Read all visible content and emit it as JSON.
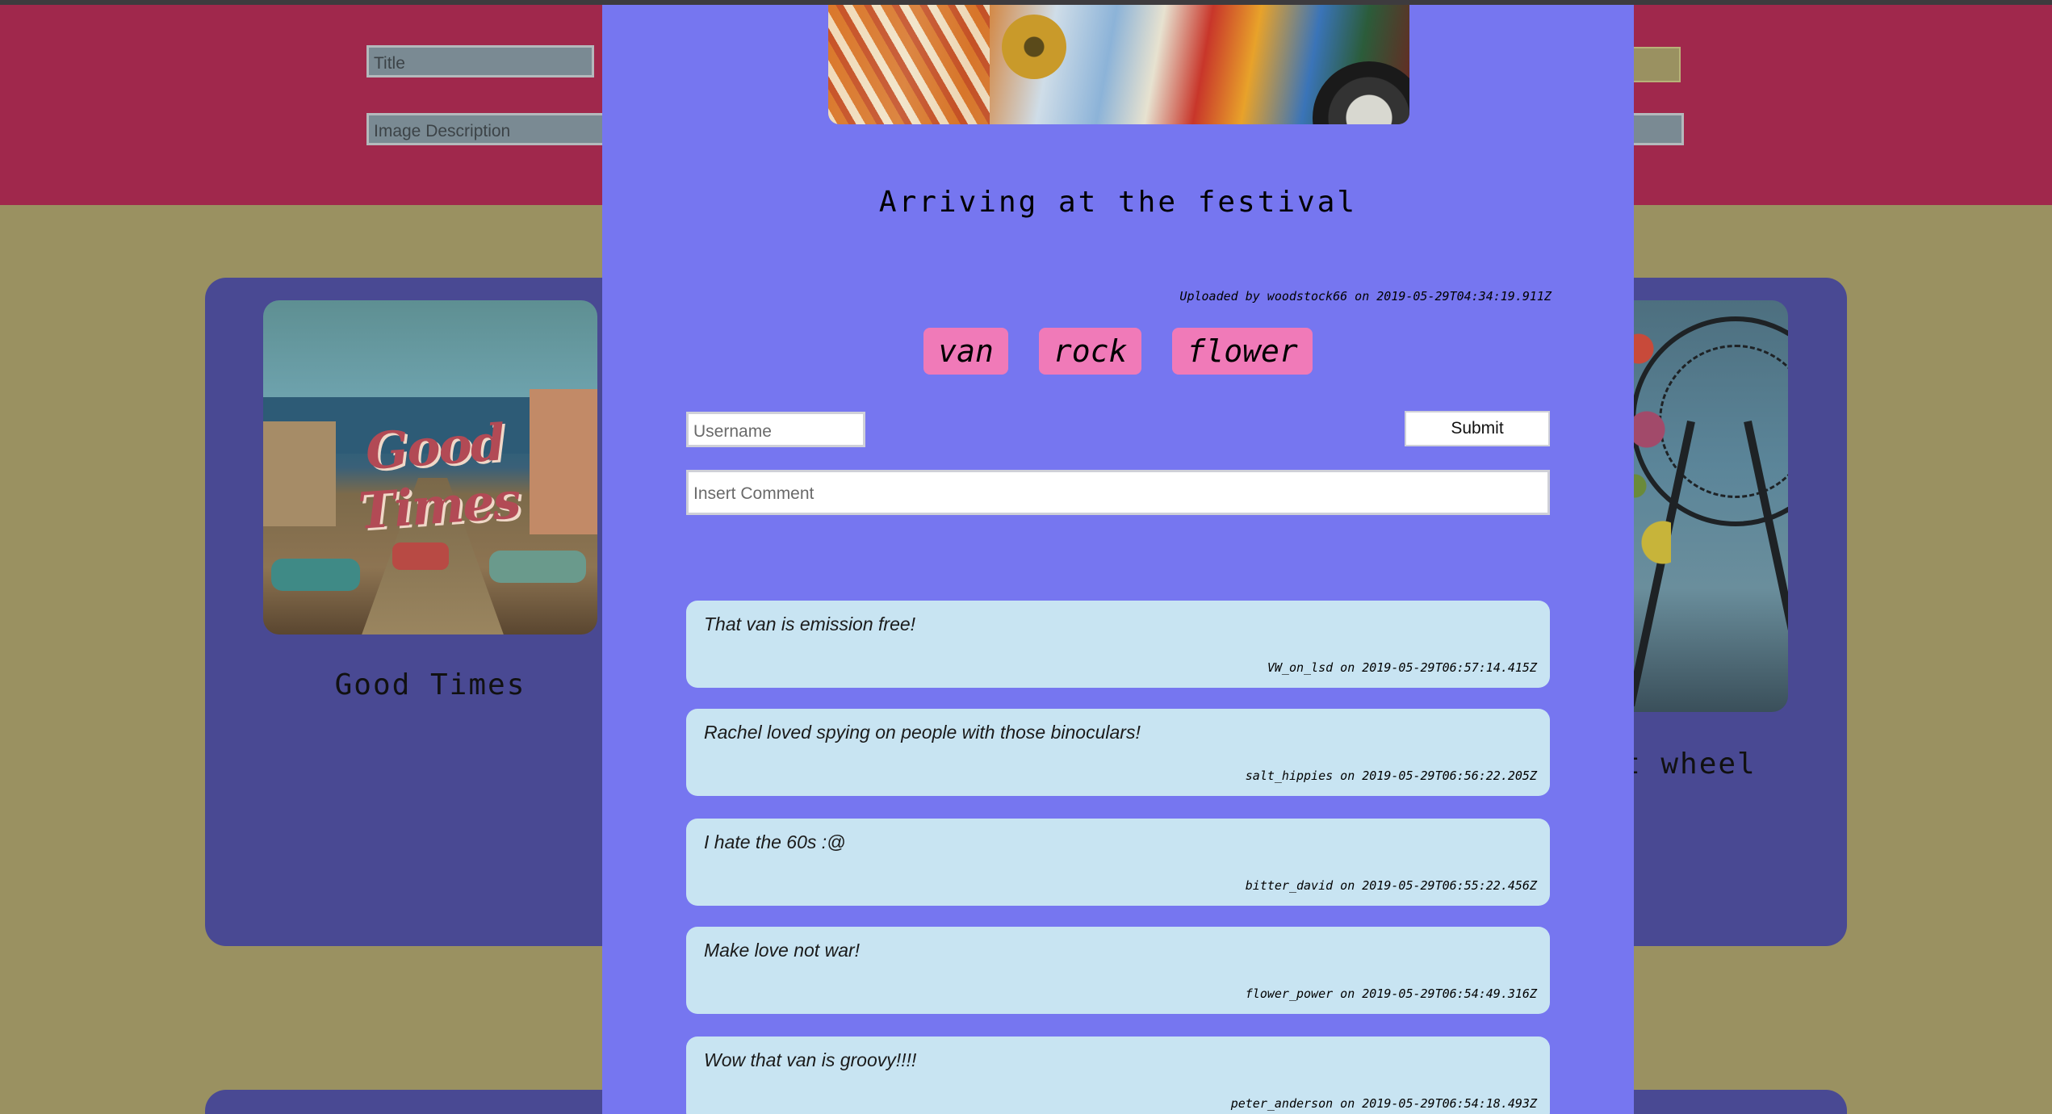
{
  "header": {
    "title_placeholder": "Title",
    "description_placeholder": "Image Description"
  },
  "gallery": {
    "cards": [
      {
        "title": "Good Times",
        "image_text": "Good Times"
      },
      {
        "title_fragment": "t wheel"
      }
    ]
  },
  "modal": {
    "title": "Arriving at the festival",
    "uploaded": "Uploaded by woodstock66 on 2019-05-29T04:34:19.911Z",
    "tags": [
      "van",
      "rock",
      "flower"
    ],
    "username_placeholder": "Username",
    "submit_label": "Submit",
    "comment_placeholder": "Insert Comment",
    "comments": [
      {
        "text": "That van is emission free!",
        "meta": "VW_on_lsd on 2019-05-29T06:57:14.415Z"
      },
      {
        "text": "Rachel loved spying on people with those binoculars!",
        "meta": "salt_hippies on 2019-05-29T06:56:22.205Z"
      },
      {
        "text": "I hate the 60s :@",
        "meta": "bitter_david on 2019-05-29T06:55:22.456Z"
      },
      {
        "text": "Make love not war!",
        "meta": "flower_power on 2019-05-29T06:54:49.316Z"
      },
      {
        "text": "Wow that van is groovy!!!!",
        "meta": "peter_anderson on 2019-05-29T06:54:18.493Z"
      }
    ]
  },
  "colors": {
    "header_bg": "#a0284c",
    "page_bg": "#9a9161",
    "card_bg": "#494993",
    "modal_bg": "#7676f0",
    "tag_bg": "#f07ab8",
    "comment_bg": "#c8e4f2"
  }
}
